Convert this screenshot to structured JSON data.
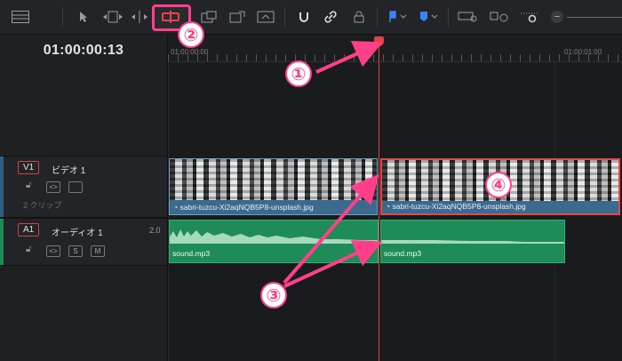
{
  "toolbar": {
    "icons": [
      "layout-icon",
      "pointer-icon",
      "trim-edit-icon",
      "dynamic-trim-icon",
      "blade-icon",
      "insert-clip-icon",
      "overwrite-clip-icon",
      "replace-clip-icon",
      "snapping-icon",
      "linked-selection-icon",
      "lock-icon",
      "flag-icon",
      "marker-icon",
      "zoom-full-icon",
      "zoom-detail-icon",
      "zoom-custom-icon",
      "zoom-out-icon"
    ],
    "zoom_out_symbol": "−",
    "highlight_color": "#ff3f8a"
  },
  "timecode": "01:00:00:13",
  "ruler": {
    "start_label": "01:00:00:00",
    "end_label": "01:00:01:00"
  },
  "tracks": {
    "video": {
      "badge": "V1",
      "name": "ビデオ 1",
      "clip_count": "2 クリップ",
      "color": "#3c6a8f"
    },
    "audio": {
      "badge": "A1",
      "name": "オーディオ 1",
      "level": "2.0",
      "solo": "S",
      "mute": "M",
      "color": "#1e8b58"
    }
  },
  "clips": {
    "video_left": "sabri-tuzcu-Xi2aqNQB5P8-unsplash.jpg",
    "video_right": "sabri-tuzcu-Xi2aqNQB5P8-unsplash.jpg",
    "audio_left": "sound.mp3",
    "audio_right": "sound.mp3"
  },
  "annotations": {
    "playhead_marker": "①",
    "blade_marker": "②",
    "cut_marker": "③",
    "selected_clip_marker": "④",
    "color": "#ff3f8a"
  },
  "playhead_color": "#e2443f"
}
